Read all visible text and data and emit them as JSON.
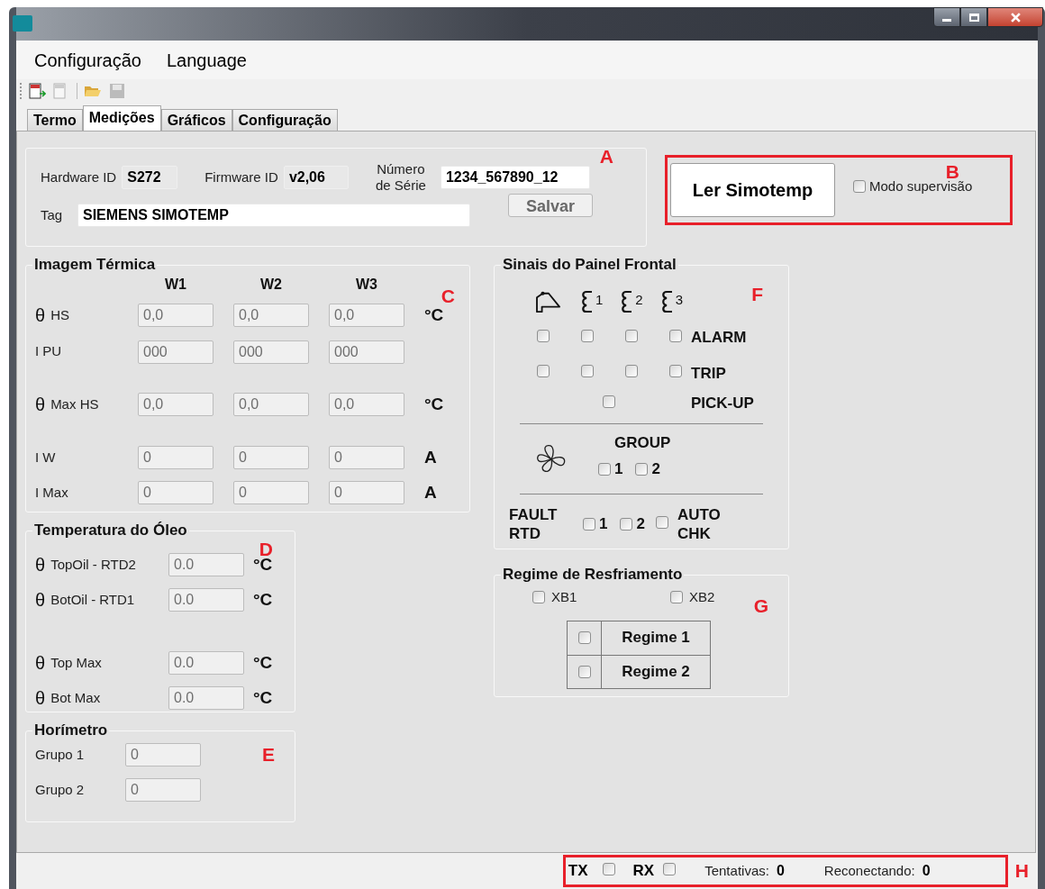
{
  "menu": [
    {
      "label": "Configuração"
    },
    {
      "label": "Language"
    }
  ],
  "tabs": [
    {
      "label": "Termo",
      "selected": false
    },
    {
      "label": "Medições",
      "selected": true
    },
    {
      "label": "Gráficos",
      "selected": false
    },
    {
      "label": "Configuração",
      "selected": false
    }
  ],
  "device": {
    "marker": "A",
    "hardware_id": {
      "label": "Hardware ID",
      "value": "S272"
    },
    "firmware_id": {
      "label": "Firmware ID",
      "value": "v2,06"
    },
    "serial": {
      "label": "Número de Série",
      "value": "1234_567890_12"
    },
    "tag": {
      "label": "Tag",
      "value": "SIEMENS SIMOTEMP"
    },
    "save_button": {
      "label": "Salvar",
      "disabled": true
    }
  },
  "read": {
    "marker": "B",
    "button": "Ler Simotemp",
    "supervision": {
      "label": "Modo supervisão",
      "checked": false
    }
  },
  "thermal_image": {
    "title": "Imagem Térmica",
    "marker": "C",
    "columns": [
      "W1",
      "W2",
      "W3"
    ],
    "rows": [
      {
        "symbol": "θ",
        "label": "HS",
        "values": [
          "0,0",
          "0,0",
          "0,0"
        ],
        "unit": "°C"
      },
      {
        "label": "I PU",
        "values": [
          "000",
          "000",
          "000"
        ]
      },
      {
        "symbol": "θ",
        "label": "Max HS",
        "values": [
          "0,0",
          "0,0",
          "0,0"
        ],
        "unit": "°C"
      },
      {
        "label": "I W",
        "values": [
          "0",
          "0",
          "0"
        ],
        "unit": "A"
      },
      {
        "label": "I Max",
        "values": [
          "0",
          "0",
          "0"
        ],
        "unit": "A"
      }
    ]
  },
  "oil_temperature": {
    "title": "Temperatura do Óleo",
    "marker": "D",
    "rows": [
      {
        "symbol": "θ",
        "label": "TopOil - RTD2",
        "value": "0.0",
        "unit": "°C"
      },
      {
        "symbol": "θ",
        "label": "BotOil - RTD1",
        "value": "0.0",
        "unit": "°C"
      },
      {
        "symbol": "θ",
        "label": "Top Max",
        "value": "0.0",
        "unit": "°C"
      },
      {
        "symbol": "θ",
        "label": "Bot Max",
        "value": "0.0",
        "unit": "°C"
      }
    ]
  },
  "hour_meter": {
    "title": "Horímetro",
    "marker": "E",
    "rows": [
      {
        "label": "Grupo 1",
        "value": "0"
      },
      {
        "label": "Grupo 2",
        "value": "0"
      }
    ]
  },
  "front_panel": {
    "title": "Sinais do Painel Frontal",
    "marker": "F",
    "windings": [
      "1",
      "2",
      "3"
    ],
    "alarm": {
      "label": "ALARM",
      "checks": [
        false,
        false,
        false,
        false
      ]
    },
    "trip": {
      "label": "TRIP",
      "checks": [
        false,
        false,
        false,
        false
      ]
    },
    "pickup": {
      "label": "PICK-UP",
      "checked": false
    },
    "group": {
      "label": "GROUP",
      "items": [
        {
          "label": "1",
          "checked": false
        },
        {
          "label": "2",
          "checked": false
        }
      ]
    },
    "fault_rtd": {
      "label": "FAULT RTD",
      "items": [
        {
          "label": "1",
          "checked": false
        },
        {
          "label": "2",
          "checked": false
        }
      ]
    },
    "auto_check": {
      "label": "AUTO CHK",
      "checked": false
    }
  },
  "cooling": {
    "title": "Regime de Resfriamento",
    "marker": "G",
    "options": [
      {
        "label": "XB1",
        "checked": false
      },
      {
        "label": "XB2",
        "checked": false
      }
    ],
    "regimes": [
      {
        "label": "Regime 1",
        "checked": false
      },
      {
        "label": "Regime 2",
        "checked": false
      }
    ]
  },
  "status_bar": {
    "marker": "H",
    "tx": {
      "label": "TX",
      "checked": false
    },
    "rx": {
      "label": "RX",
      "checked": false
    },
    "attempts": {
      "label": "Tentativas:",
      "value": "0"
    },
    "reconnecting": {
      "label": "Reconectando:",
      "value": "0"
    }
  }
}
